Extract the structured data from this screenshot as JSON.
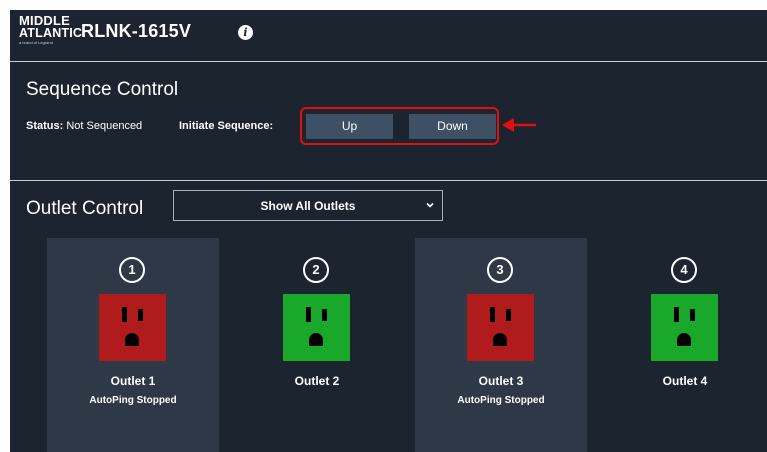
{
  "header": {
    "logo_line1": "MIDDLE",
    "logo_line2": "ATLANTIC.",
    "logo_tagline": "a brand of Legrand",
    "model": "RLNK-1615V",
    "info_icon": "info-icon"
  },
  "sequence": {
    "title": "Sequence Control",
    "status_label": "Status:",
    "status_value": "Not Sequenced",
    "initiate_label": "Initiate Sequence:",
    "up_label": "Up",
    "down_label": "Down",
    "highlight_color": "#e01010"
  },
  "outlet_control": {
    "title": "Outlet Control",
    "filter_selected": "Show All Outlets",
    "outlets": [
      {
        "number": "1",
        "name": "Outlet 1",
        "status": "AutoPing Stopped",
        "state": "off",
        "color": "#b01c1c"
      },
      {
        "number": "2",
        "name": "Outlet 2",
        "status": "",
        "state": "on",
        "color": "#1aa82a"
      },
      {
        "number": "3",
        "name": "Outlet 3",
        "status": "AutoPing Stopped",
        "state": "off",
        "color": "#b01c1c"
      },
      {
        "number": "4",
        "name": "Outlet 4",
        "status": "",
        "state": "on",
        "color": "#1aa82a"
      }
    ]
  },
  "colors": {
    "background": "#1c2430",
    "card_active": "#2e3846",
    "button": "#3e5064",
    "outlet_off": "#b01c1c",
    "outlet_on": "#1aa82a"
  }
}
